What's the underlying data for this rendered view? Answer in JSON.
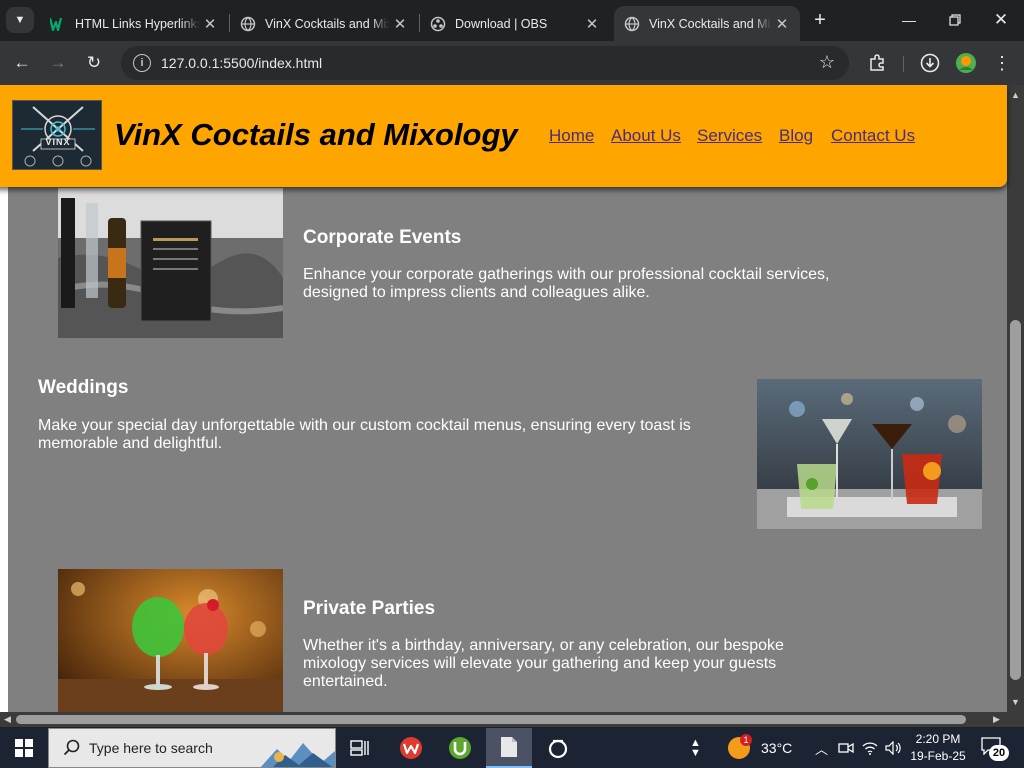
{
  "browser": {
    "tabs": [
      {
        "title": "HTML Links Hyperlinks",
        "favicon": "w3schools-icon"
      },
      {
        "title": "VinX Cocktails and Mixology",
        "favicon": "globe-icon"
      },
      {
        "title": "Download | OBS",
        "favicon": "obs-icon"
      },
      {
        "title": "VinX Cocktails and Mixology",
        "favicon": "globe-icon",
        "active": true
      }
    ],
    "url": "127.0.0.1:5500/index.html"
  },
  "site": {
    "logo_text": "VINX",
    "title": "VinX Coctails and Mixology",
    "nav": [
      "Home",
      "About Us",
      "Services",
      "Blog",
      "Contact Us"
    ]
  },
  "services": [
    {
      "title": "Corporate Events",
      "desc": "Enhance your corporate gatherings with our professional cocktail services, designed to impress clients and colleagues alike."
    },
    {
      "title": "Weddings",
      "desc": "Make your special day unforgettable with our custom cocktail menus, ensuring every toast is memorable and delightful."
    },
    {
      "title": "Private Parties",
      "desc": "Whether it's a birthday, anniversary, or any celebration, our bespoke mixology services will elevate your gathering and keep your guests entertained."
    }
  ],
  "taskbar": {
    "search_placeholder": "Type here to search",
    "weather_temp": "33°C",
    "weather_badge": "1",
    "time": "2:20 PM",
    "date": "19-Feb-25",
    "notification_count": "20"
  },
  "colors": {
    "header_bg": "#ffa500",
    "page_bg": "#808080",
    "nav_link": "#4a2c7a"
  }
}
